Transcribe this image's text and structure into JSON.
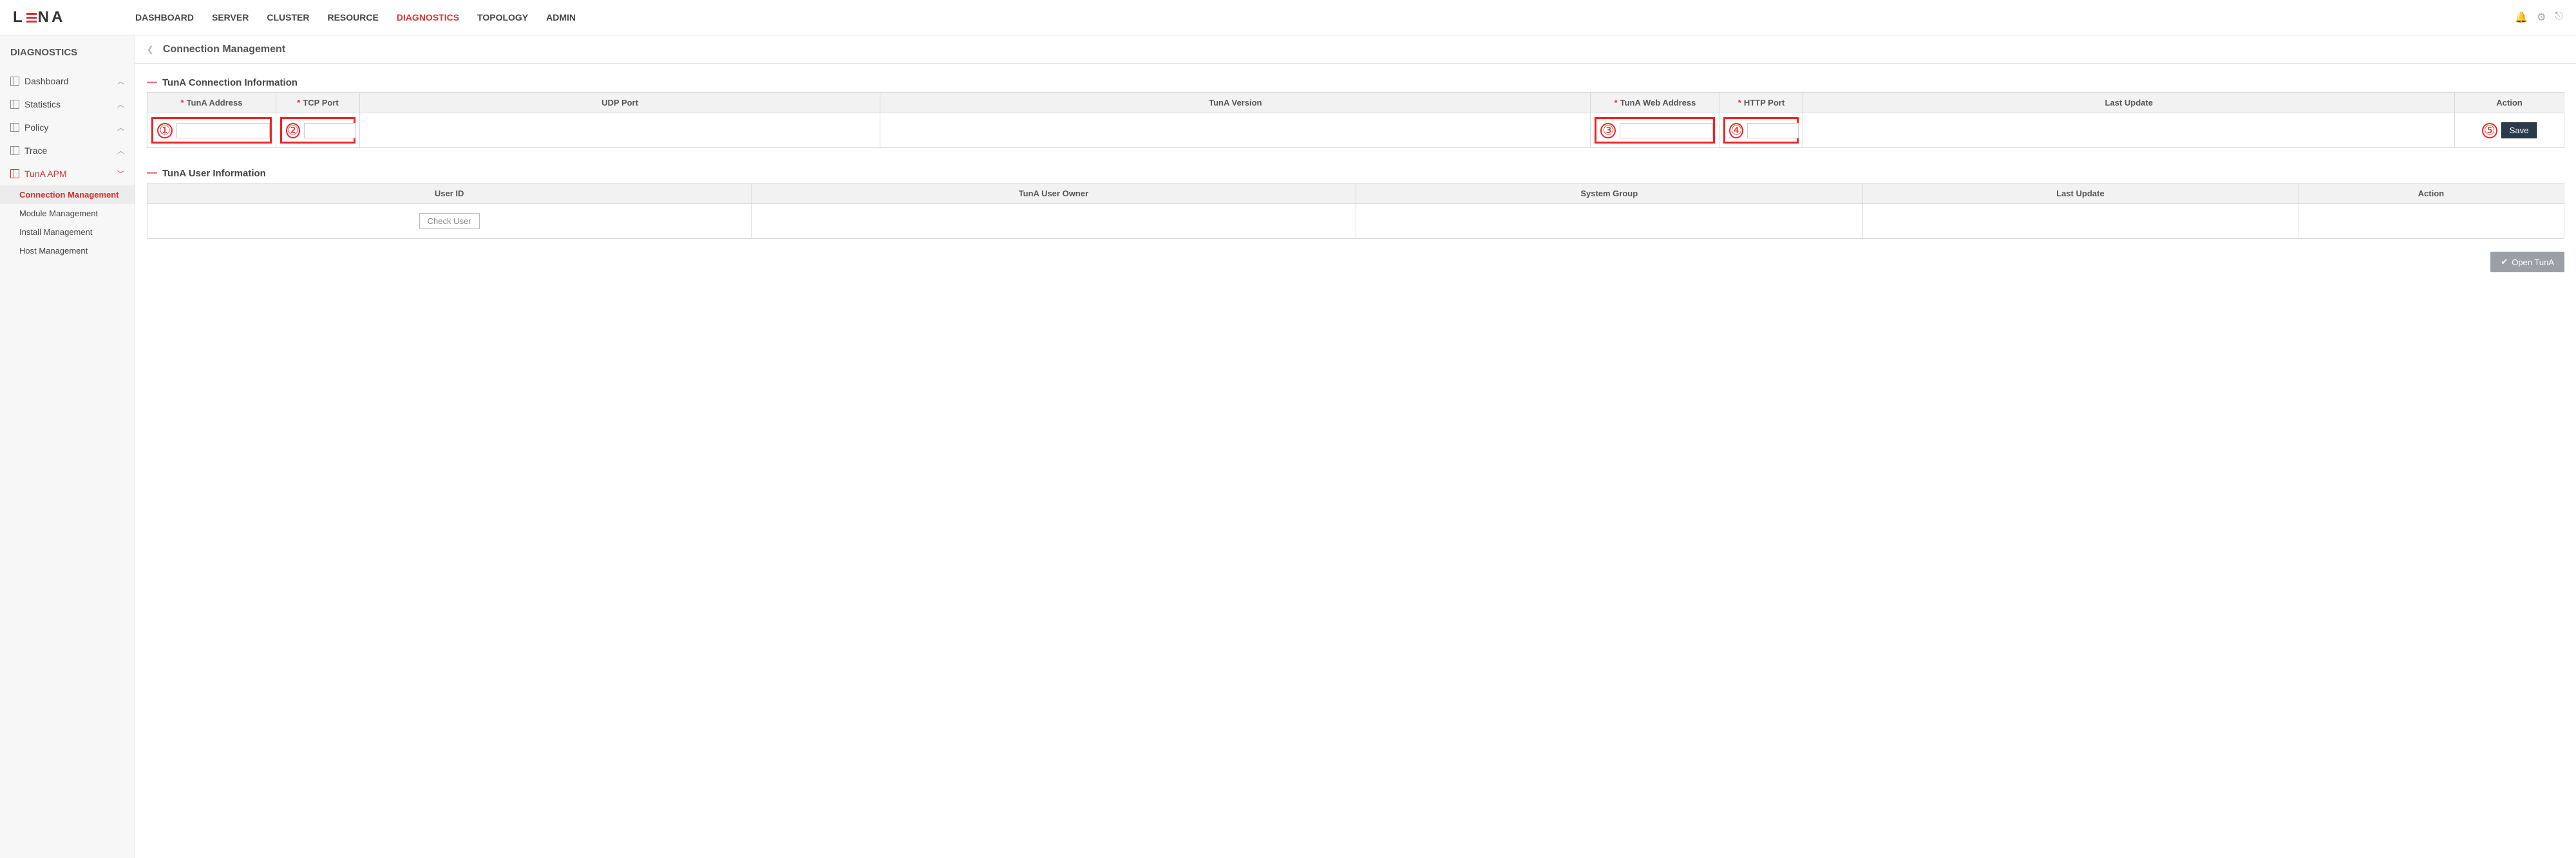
{
  "brand": {
    "left": "L",
    "right": "NA"
  },
  "nav": {
    "items": [
      "DASHBOARD",
      "SERVER",
      "CLUSTER",
      "RESOURCE",
      "DIAGNOSTICS",
      "TOPOLOGY",
      "ADMIN"
    ],
    "active": "DIAGNOSTICS"
  },
  "sidebar": {
    "title": "DIAGNOSTICS",
    "groups": [
      {
        "label": "Dashboard",
        "expanded": false
      },
      {
        "label": "Statistics",
        "expanded": false
      },
      {
        "label": "Policy",
        "expanded": false
      },
      {
        "label": "Trace",
        "expanded": false
      },
      {
        "label": "TunA APM",
        "expanded": true,
        "active": true,
        "children": [
          {
            "label": "Connection Management",
            "active": true
          },
          {
            "label": "Module Management"
          },
          {
            "label": "Install Management"
          },
          {
            "label": "Host Management"
          }
        ]
      }
    ]
  },
  "page": {
    "title": "Connection Management"
  },
  "section1": {
    "title": "TunA Connection Information",
    "headers": {
      "tuna_address": "TunA Address",
      "tcp_port": "TCP Port",
      "udp_port": "UDP Port",
      "tuna_version": "TunA Version",
      "tuna_web_address": "TunA Web Address",
      "http_port": "HTTP Port",
      "last_update": "Last Update",
      "action": "Action"
    },
    "row": {
      "tuna_address": "",
      "tcp_port": "",
      "udp_port": "",
      "tuna_version": "",
      "tuna_web_address": "",
      "http_port": "",
      "last_update": "",
      "save_label": "Save"
    },
    "annotations": {
      "a1": "①",
      "a2": "②",
      "a3": "③",
      "a4": "④",
      "a5": "⑤"
    }
  },
  "section2": {
    "title": "TunA User Information",
    "headers": {
      "user_id": "User ID",
      "owner": "TunA User Owner",
      "system_group": "System Group",
      "last_update": "Last Update",
      "action": "Action"
    },
    "row": {
      "check_user_label": "Check User"
    }
  },
  "footer": {
    "open_label": "Open TunA"
  }
}
